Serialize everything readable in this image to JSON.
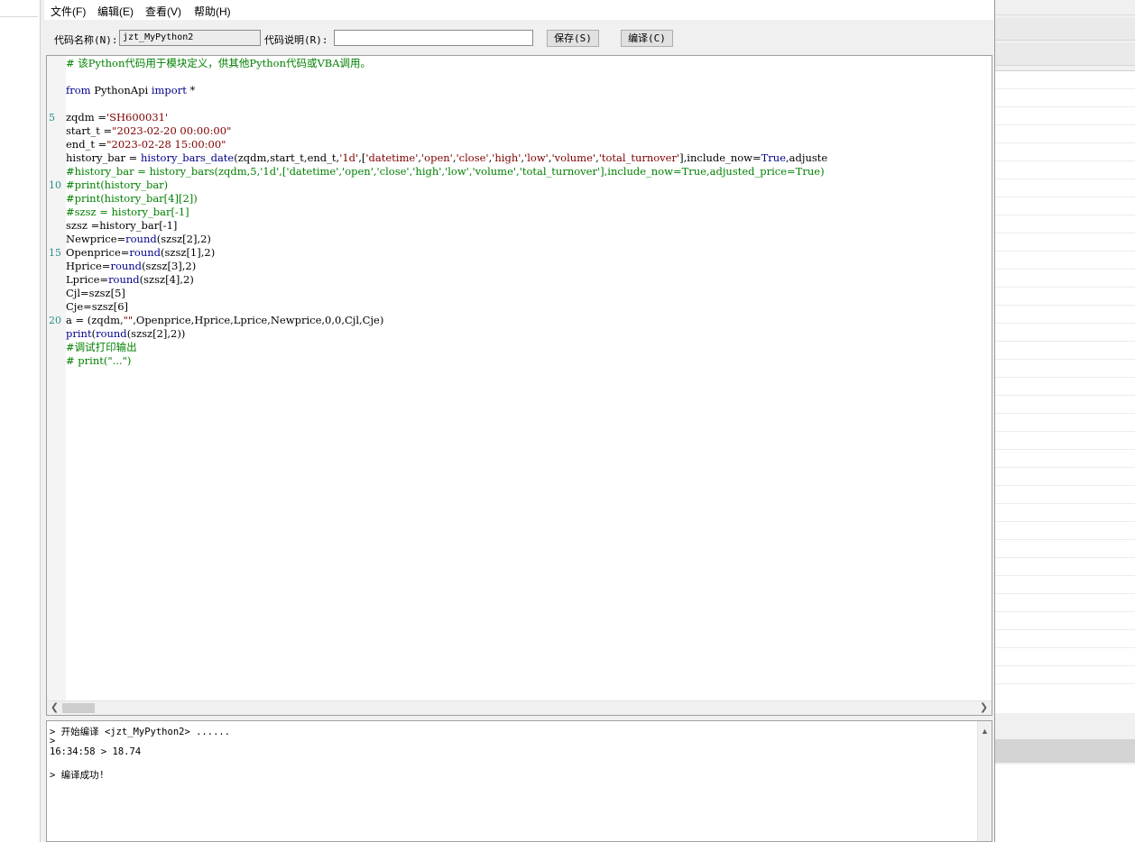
{
  "menubar": {
    "items": [
      "文件(F)",
      "编辑(E)",
      "查看(V)",
      "帮助(H)"
    ]
  },
  "toolbar": {
    "code_name_label": "代码名称(N):",
    "code_name_value": "jzt_MyPython2",
    "code_desc_label": "代码说明(R):",
    "code_desc_value": "",
    "save_button": "保存(S)",
    "compile_button": "编译(C)"
  },
  "editor": {
    "lines": [
      {
        "ln": "",
        "text": "# 该Python代码用于模块定义，供其他Python代码或VBA调用。"
      },
      {
        "ln": "",
        "text": ""
      },
      {
        "ln": "",
        "text": "from PythonApi import *"
      },
      {
        "ln": "",
        "text": ""
      },
      {
        "ln": "5",
        "text": "zqdm ='SH600031'"
      },
      {
        "ln": "",
        "text": "start_t =\"2023-02-20 00:00:00\""
      },
      {
        "ln": "",
        "text": "end_t =\"2023-02-28 15:00:00\""
      },
      {
        "ln": "",
        "text": "history_bar = history_bars_date(zqdm,start_t,end_t,'1d',['datetime','open','close','high','low','volume','total_turnover'],include_now=True,adjuste"
      },
      {
        "ln": "",
        "text": "#history_bar = history_bars(zqdm,5,'1d',['datetime','open','close','high','low','volume','total_turnover'],include_now=True,adjusted_price=True)"
      },
      {
        "ln": "10",
        "text": "#print(history_bar)"
      },
      {
        "ln": "",
        "text": "#print(history_bar[4][2])"
      },
      {
        "ln": "",
        "text": "#szsz = history_bar[-1]"
      },
      {
        "ln": "",
        "text": "szsz =history_bar[-1]"
      },
      {
        "ln": "",
        "text": "Newprice=round(szsz[2],2)"
      },
      {
        "ln": "15",
        "text": "Openprice=round(szsz[1],2)"
      },
      {
        "ln": "",
        "text": "Hprice=round(szsz[3],2)"
      },
      {
        "ln": "",
        "text": "Lprice=round(szsz[4],2)"
      },
      {
        "ln": "",
        "text": "Cjl=szsz[5]"
      },
      {
        "ln": "",
        "text": "Cje=szsz[6]"
      },
      {
        "ln": "20",
        "text": "a = (zqdm,\"\",Openprice,Hprice,Lprice,Newprice,0,0,Cjl,Cje)"
      },
      {
        "ln": "",
        "text": "print(round(szsz[2],2))"
      },
      {
        "ln": "",
        "text": "#调试打印输出"
      },
      {
        "ln": "",
        "text": "# print(\"...\")"
      }
    ]
  },
  "output": {
    "lines": [
      "> 开始编译 <jzt_MyPython2> ......",
      ">",
      "16:34:58 > 18.74",
      "",
      "> 编译成功!"
    ]
  },
  "colors": {
    "comment": "#008000",
    "keyword": "#00008b",
    "string": "#800000",
    "line_number": "#2b8c8c"
  },
  "icons": {
    "scroll_left": "scroll-left-icon",
    "scroll_right": "scroll-right-icon",
    "scroll_up": "scroll-up-icon",
    "scroll_down": "scroll-down-icon"
  }
}
